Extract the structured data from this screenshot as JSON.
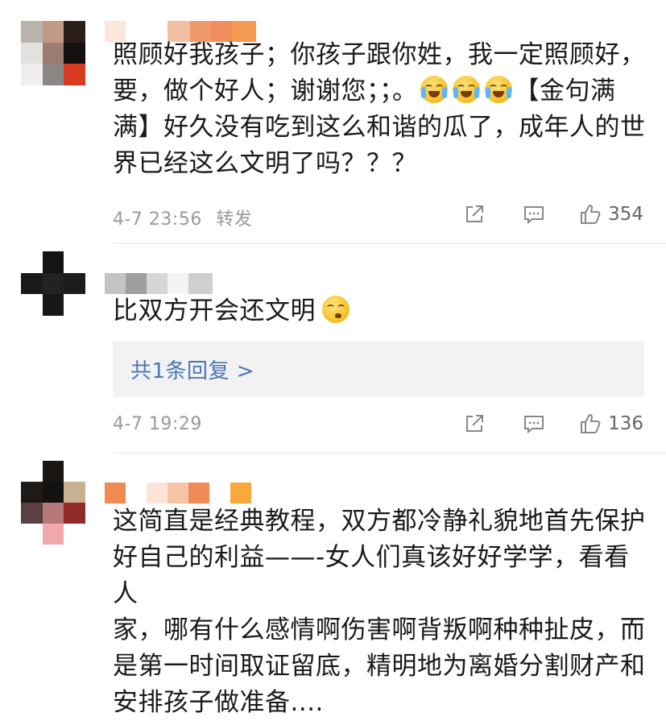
{
  "comments": [
    {
      "text_lines": [
        "照顾好我孩子；你孩子跟你姓，我一定照顾好，",
        "要，做个好人；谢谢您；；。",
        "满】好久没有吃到这么和谐的瓜了，成年人的世",
        "界已经这么文明了吗？？？"
      ],
      "inline_tail": "【金句满",
      "time": "4-7 23:56",
      "forward_label": "转发",
      "likes": "354",
      "emoji": "laugh-cry-emoji"
    },
    {
      "text": "比双方开会还文明",
      "emoji": "thinking-emoji",
      "reply_link": "共1条回复 >",
      "time": "4-7 19:29",
      "likes": "136"
    },
    {
      "text_lines": [
        "这简直是经典教程，双方都冷静礼貌地首先保护",
        "好自己的利益——-女人们真该好好学学，看看人",
        "家，哪有什么感情啊伤害啊背叛啊种种扯皮，而",
        "是第一时间取证留底，精明地为离婚分割财产和",
        "安排孩子做准备...."
      ]
    }
  ]
}
